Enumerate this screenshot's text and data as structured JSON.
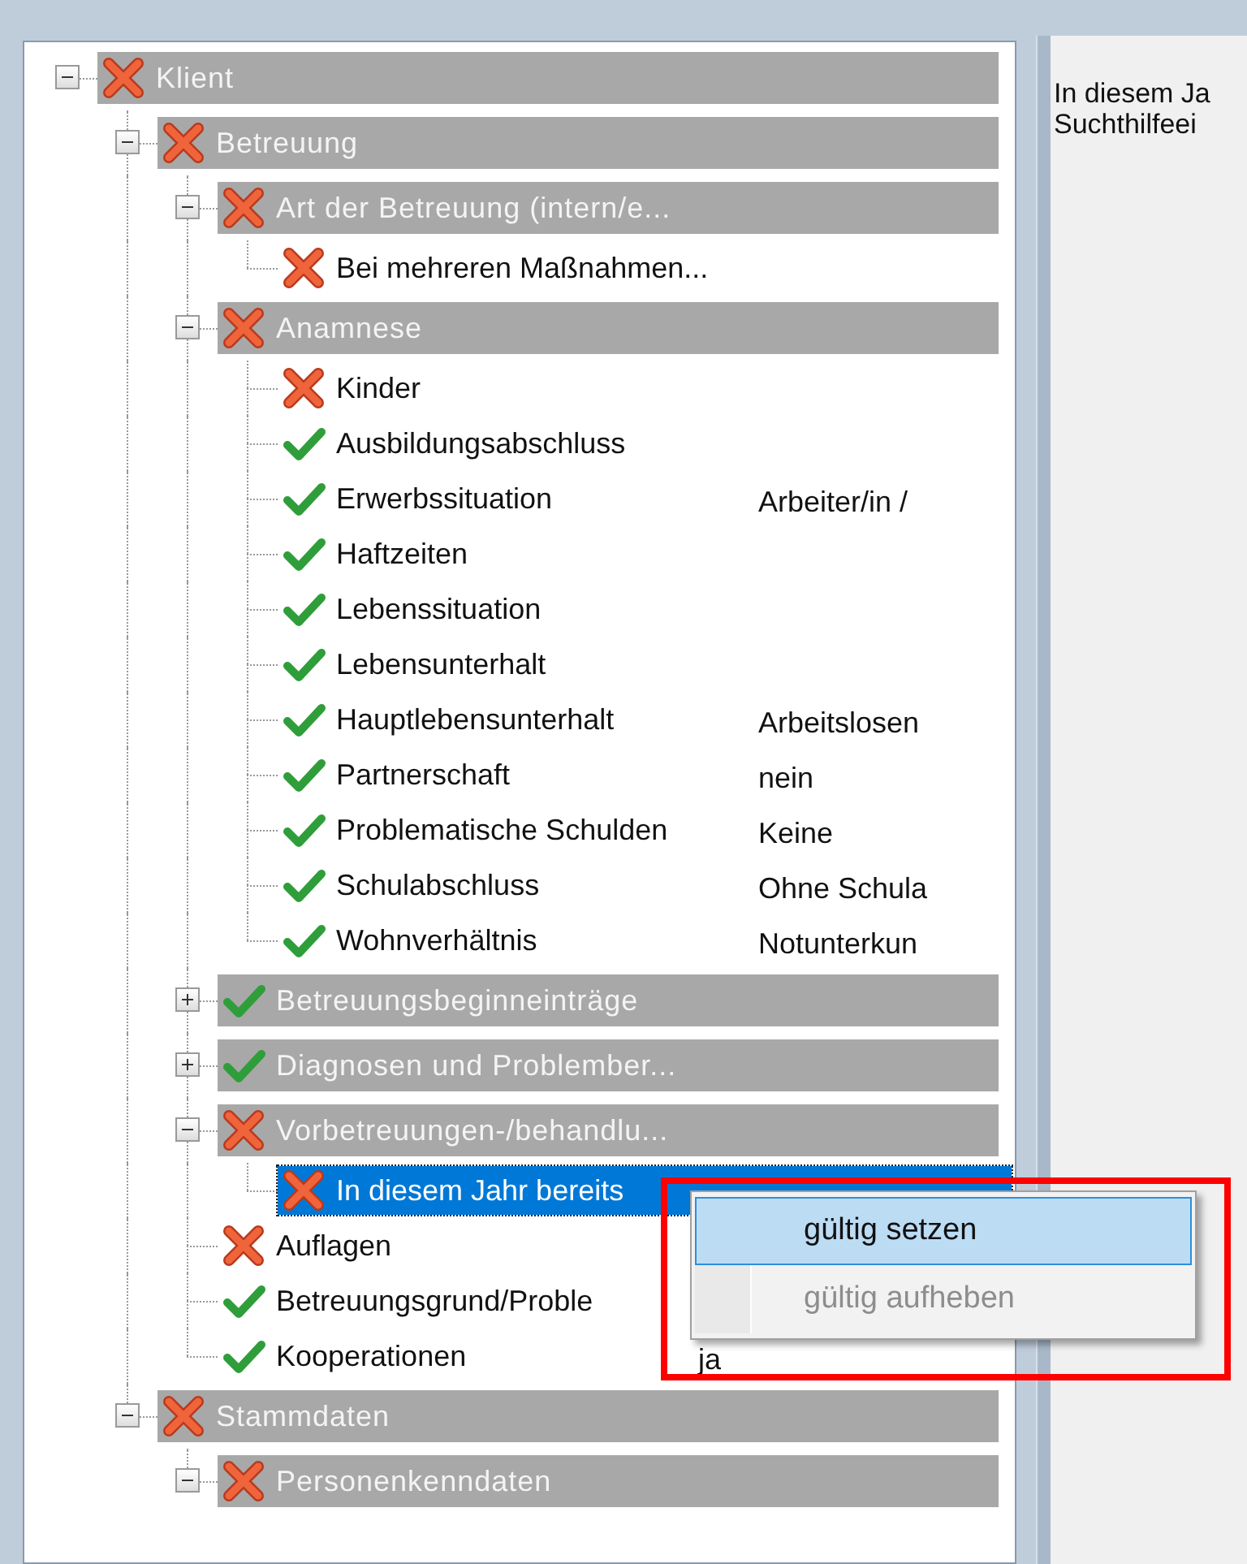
{
  "tree": [
    {
      "kind": "group",
      "label": "Klient",
      "valid": false,
      "expanded": true,
      "selected": false,
      "children": [
        {
          "kind": "group",
          "label": "Betreuung",
          "valid": false,
          "expanded": true,
          "selected": false,
          "children": [
            {
              "kind": "group",
              "label": "Art der Betreuung (intern/e...",
              "valid": false,
              "expanded": true,
              "selected": false,
              "children": [
                {
                  "kind": "item",
                  "label": "Bei  mehreren  Maßnahmen...",
                  "valid": false,
                  "selected": false
                }
              ]
            },
            {
              "kind": "group",
              "label": "Anamnese",
              "valid": false,
              "expanded": true,
              "selected": false,
              "children": [
                {
                  "kind": "item",
                  "label": "Kinder",
                  "valid": false,
                  "selected": false
                },
                {
                  "kind": "item",
                  "label": "Ausbildungsabschluss",
                  "valid": true,
                  "selected": false
                },
                {
                  "kind": "item",
                  "label": "Erwerbssituation",
                  "value": "Arbeiter/in /",
                  "valid": true,
                  "selected": false
                },
                {
                  "kind": "item",
                  "label": "Haftzeiten",
                  "valid": true,
                  "selected": false
                },
                {
                  "kind": "item",
                  "label": "Lebenssituation",
                  "valid": true,
                  "selected": false
                },
                {
                  "kind": "item",
                  "label": "Lebensunterhalt",
                  "valid": true,
                  "selected": false
                },
                {
                  "kind": "item",
                  "label": "Hauptlebensunterhalt",
                  "value": "Arbeitslosen",
                  "valid": true,
                  "selected": false
                },
                {
                  "kind": "item",
                  "label": "Partnerschaft",
                  "value": "nein",
                  "valid": true,
                  "selected": false
                },
                {
                  "kind": "item",
                  "label": "Problematische Schulden",
                  "value": "Keine",
                  "valid": true,
                  "selected": false
                },
                {
                  "kind": "item",
                  "label": "Schulabschluss",
                  "value": "Ohne Schula",
                  "valid": true,
                  "selected": false
                },
                {
                  "kind": "item",
                  "label": "Wohnverhältnis",
                  "value": "Notunterkun",
                  "valid": true,
                  "selected": false
                }
              ]
            },
            {
              "kind": "group",
              "label": "Betreuungsbeginneinträge",
              "valid": true,
              "expanded": false,
              "selected": false
            },
            {
              "kind": "group",
              "label": "Diagnosen  und  Problember...",
              "valid": true,
              "expanded": false,
              "selected": false
            },
            {
              "kind": "group",
              "label": "Vorbetreuungen-/behandlu...",
              "valid": false,
              "expanded": true,
              "selected": false,
              "children": [
                {
                  "kind": "item",
                  "label": "In diesem Jahr bereits",
                  "valid": false,
                  "selected": true
                }
              ]
            },
            {
              "kind": "item",
              "label": "Auflagen",
              "valid": false,
              "selected": false
            },
            {
              "kind": "item",
              "label": "Betreuungsgrund/Proble",
              "valid": true,
              "selected": false
            },
            {
              "kind": "item",
              "label": "Kooperationen",
              "value": "ja",
              "valid": true,
              "selected": false
            }
          ]
        },
        {
          "kind": "group",
          "label": "Stammdaten",
          "valid": false,
          "expanded": true,
          "selected": false,
          "children": [
            {
              "kind": "group",
              "label": "Personenkenndaten",
              "valid": false,
              "expanded": true,
              "selected": false
            }
          ]
        }
      ]
    }
  ],
  "context_menu": {
    "items": [
      {
        "label": "gültig setzen",
        "selected": true,
        "disabled": false
      },
      {
        "label": "gültig aufheben",
        "selected": false,
        "disabled": true
      }
    ]
  },
  "detail_panel": {
    "lines": [
      "In diesem Ja",
      "Suchthilfeei"
    ]
  }
}
